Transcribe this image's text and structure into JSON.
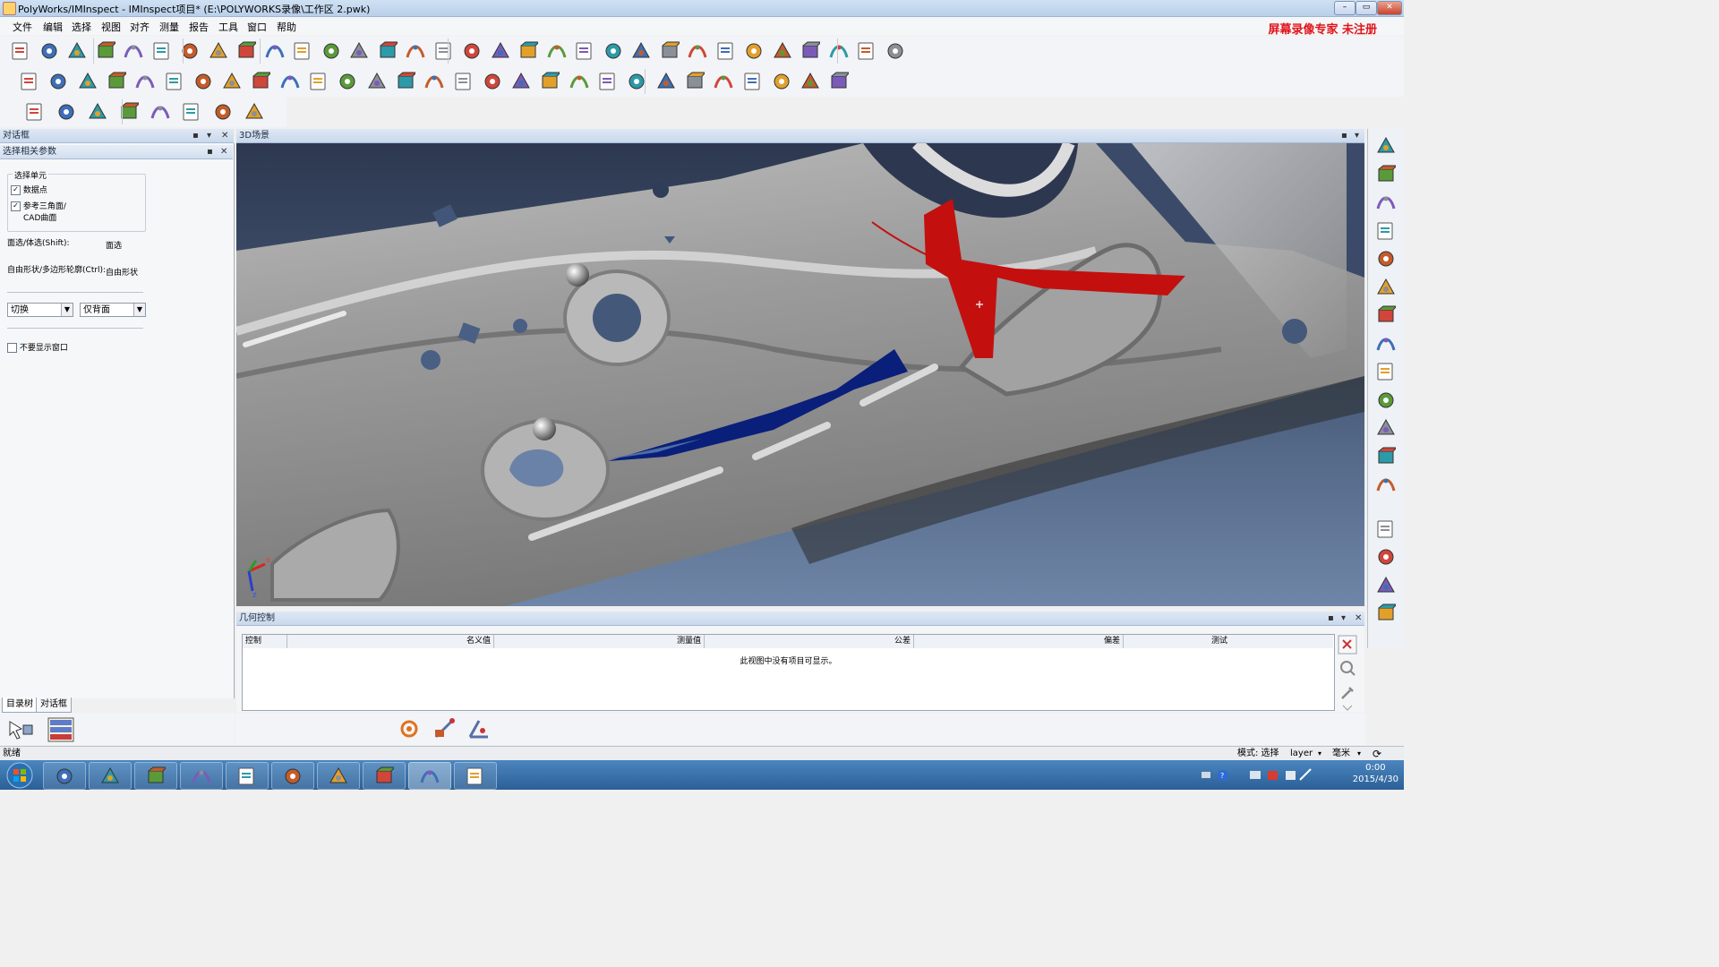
{
  "window": {
    "title": "PolyWorks/IMInspect - IMInspect项目* (E:\\POLYWORKS录像\\工作区 2.pwk)",
    "controls": [
      "minimize",
      "maximize",
      "close"
    ]
  },
  "menu": {
    "items": [
      "文件",
      "编辑",
      "选择",
      "视图",
      "对齐",
      "测量",
      "报告",
      "工具",
      "窗口",
      "帮助"
    ],
    "watermark": "屏幕录像专家  未注册"
  },
  "toolbars": {
    "row1_icons": [
      "new-file-icon",
      "open-folder-icon",
      "save-icon",
      "undo-icon",
      "cancel-icon",
      "redo-icon",
      "microphone-icon",
      "settings-window-icon",
      "import-icon",
      "probe-icon",
      "laser-icon",
      "binary-data-icon",
      "cube-icon",
      "align-icon",
      "color-cube-icon",
      "surface-icon",
      "curve-icon",
      "pen-icon",
      "fit-icon",
      "measure-icon",
      "table-icon",
      "cloud-icon",
      "wrench-icon",
      "compass-icon",
      "spreadsheet-icon",
      "camera-icon",
      "report-icon",
      "feature-1-icon",
      "feature-2-icon",
      "feature-3-icon",
      "feature-4-icon",
      "feature-5-icon"
    ],
    "row2_icons": [
      "points-icon",
      "grid-points-icon",
      "scatter-icon",
      "line-icon",
      "plane-icon",
      "circle-icon",
      "slot-icon",
      "rectangle-icon",
      "polygon-icon",
      "ellipse-icon",
      "cylinder-icon",
      "cone-icon",
      "sphere-icon",
      "torus-icon",
      "box-icon",
      "curve-2-icon",
      "network-icon",
      "distance-icon",
      "angle-icon",
      "sun-icon",
      "add-icon",
      "pointer-icon",
      "caliper-1-icon",
      "caliper-2-icon",
      "caliper-3-icon",
      "caliper-4-icon",
      "caliper-5-icon",
      "frame-icon",
      "select-box-icon"
    ],
    "row3_icons": [
      "curve-select-icon",
      "spiral-icon",
      "curve-box-icon",
      "color-map-icon",
      "wave-icon",
      "cubes-icon",
      "normal-icon",
      "height-icon"
    ]
  },
  "left_panel": {
    "header": "对话框",
    "subheader": "选择相关参数",
    "group_title": "选择单元",
    "checkbox_data_points": "数据点",
    "checkbox_ref_triangles": "参考三角面/",
    "checkbox_ref_triangles_line2": "CAD曲面",
    "polygon_select_label": "面选/体选(Shift):",
    "polygon_select_value": "面选",
    "freeform_label": "自由形状/多边形轮廓(Ctrl):",
    "freeform_value": "自由形状",
    "mode_select": "切换",
    "face_select": "仅背面",
    "no_show_window": "不要显示窗口",
    "tabs": [
      "目录树",
      "对话框"
    ]
  },
  "scene": {
    "header": "3D场景",
    "axis_z": "z",
    "axis_x": "x"
  },
  "geometry_control": {
    "header": "几何控制",
    "columns": [
      "控制",
      "名义值",
      "测量值",
      "公差",
      "偏差",
      "测试"
    ],
    "empty_message": "此视图中没有项目可显示。"
  },
  "status": {
    "left": "就绪",
    "mode": "模式: 选择",
    "layer": "layer",
    "unit": "毫米"
  },
  "taskbar": {
    "apps": [
      "start-icon",
      "firefox-icon",
      "ie-icon",
      "s-app-icon",
      "360-icon",
      "folder-icon",
      "red-app-icon",
      "mail-icon",
      "note-icon",
      "polyworks-icon",
      "word-icon"
    ],
    "time": "0:00",
    "date": "2015/4/30"
  },
  "colors": {
    "red_feature": "#c40f0f",
    "blue_feature": "#0a1f7a",
    "watermark": "#e0141b"
  }
}
